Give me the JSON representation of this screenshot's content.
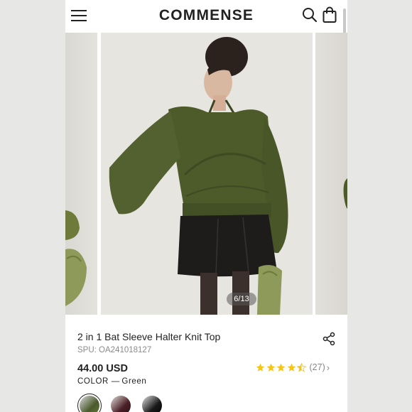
{
  "header": {
    "logo": "COMMENSE",
    "menu_icon": "hamburger-menu-icon",
    "search_icon": "search-icon",
    "bag_icon": "shopping-bag-icon"
  },
  "gallery": {
    "counter": "6/13"
  },
  "product": {
    "title": "2 in 1 Bat Sleeve Halter Knit Top",
    "spu": "SPU: OA241018127",
    "price": "44.00 USD",
    "color_label": "COLOR",
    "color_value": "Green",
    "rating": 4.5,
    "review_count": "(27)",
    "share_icon": "share-icon"
  },
  "swatches": [
    {
      "name": "Green",
      "color": "#4a5a2c",
      "selected": true
    },
    {
      "name": "Burgundy",
      "color": "#4a1f26",
      "selected": false
    },
    {
      "name": "Black",
      "color": "#1a1a1a",
      "selected": false
    }
  ],
  "colors": {
    "star": "#f5c518",
    "sweater": "#4d5b2b",
    "background": "#e7e7e5"
  }
}
